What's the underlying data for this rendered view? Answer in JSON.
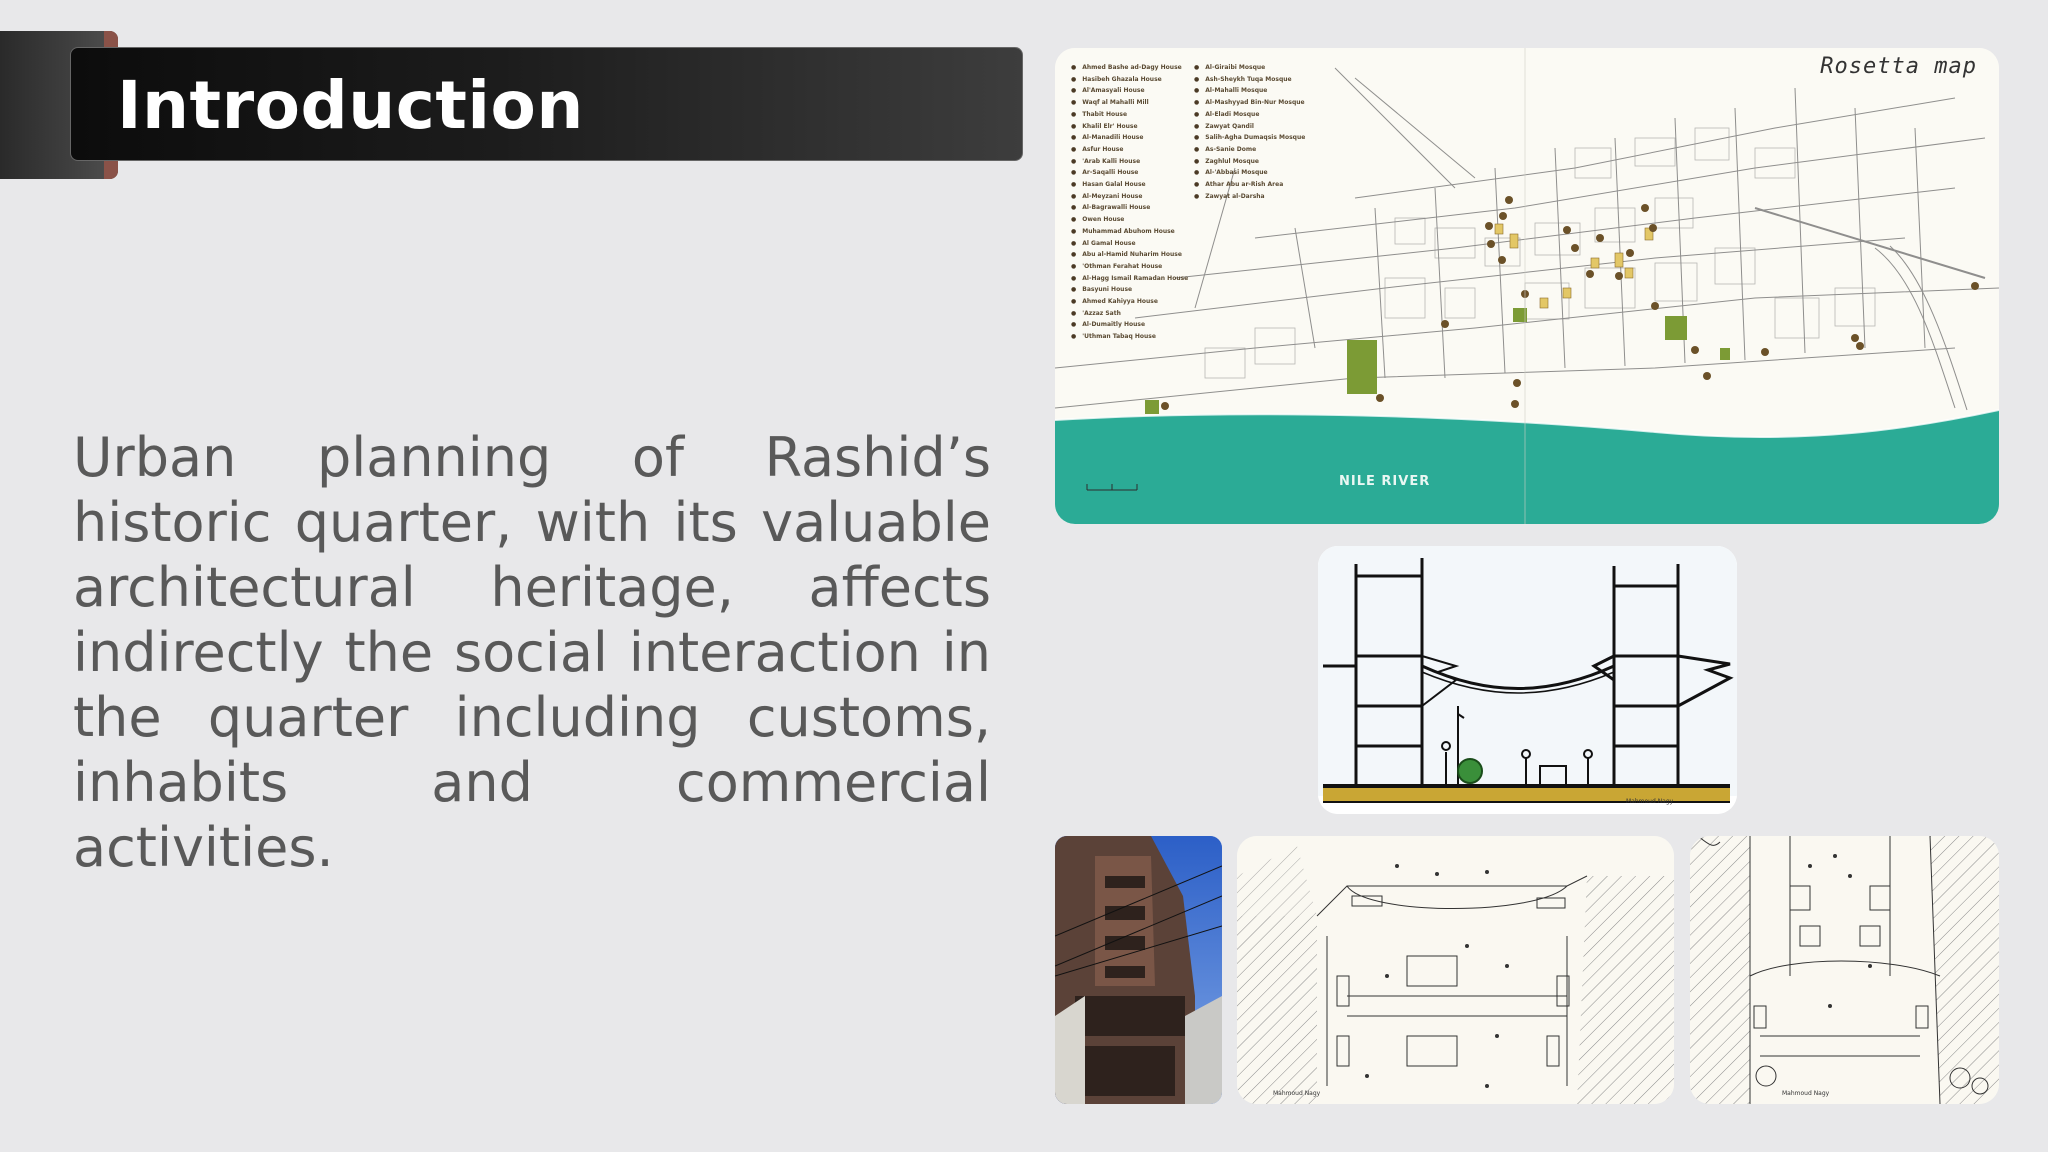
{
  "slide": {
    "title": "Introduction",
    "body": "Urban planning of Rashid’s historic quarter, with its valuable architectural heritage, affects indirectly the social interaction in the quarter including customs, inhabits and commercial activities."
  },
  "map": {
    "caption": "Rosetta map",
    "river_label": "NILE RIVER",
    "legend_left": [
      "Ahmed Bashe ad-Dagy House",
      "Hasibeh Ghazala House",
      "Al'Amasyali House",
      "Waqf al Mahalli Mill",
      "Thabit House",
      "Khalil Elr' House",
      "Al-Manadili House",
      "Asfur House",
      "'Arab Kalli House",
      "Ar-Saqalli House",
      "Hasan Galal House",
      "Al-Meyzani House",
      "Al-Bagrawalli House",
      "Owen House",
      "Muhammad Abuhom House",
      "Al Gamal House",
      "Abu al-Hamid Nuharim House",
      "'Othman Ferahat House",
      "Al-Hagg Ismail Ramadan House",
      "Basyuni House",
      "Ahmed Kahiyya House",
      "'Azzaz Sath",
      "Al-Dumaitly House",
      "'Uthman Tabaq House"
    ],
    "legend_right": [
      "Al-Giraibi Mosque",
      "Ash-Sheykh Tuqa Mosque",
      "Al-Mahalli Mosque",
      "Al-Mashyyad Bin-Nur Mosque",
      "Al-Eladi Mosque",
      "Zawyat Qandil",
      "Salih-Agha Dumaqsis Mosque",
      "As-Sanie Dome",
      "Zaghlul Mosque",
      "Al-'Abbasi Mosque",
      "Athar Abu ar-Rish Area",
      "Zawyat al-Darsha"
    ]
  },
  "signatures": {
    "section": "Mahmoud Nagy",
    "plan1": "Mahmoud Nagy",
    "plan2": "Mahmoud Nagy"
  },
  "colors": {
    "title_bar": "#1c1c1c",
    "tab_accent": "#8a5248",
    "body_text": "#595959",
    "river": "#2bab96",
    "green_area": "#7c9b35",
    "highlight_building": "#e3c766"
  }
}
